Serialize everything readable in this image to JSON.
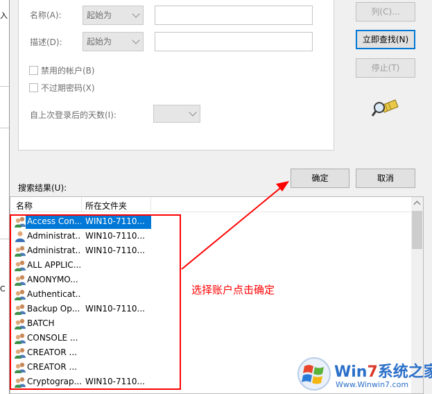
{
  "background": {
    "fragments": [
      "入",
      "C"
    ]
  },
  "form": {
    "name_label": "名称(A):",
    "name_mode": "起始为",
    "name_value": "",
    "desc_label": "描述(D):",
    "desc_mode": "起始为",
    "desc_value": "",
    "disabled_accounts": "禁用的帐户(B)",
    "non_expiring_pw": "不过期密码(X)",
    "days_since_logon_label": "自上次登录后的天数(I):",
    "days_since_logon_value": ""
  },
  "buttons": {
    "columns": "列(C)...",
    "find_now": "立即查找(N)",
    "stop": "停止(T)",
    "ok": "确定",
    "cancel": "取消"
  },
  "results": {
    "label": "搜索结果(U):",
    "columns": [
      "名称",
      "所在文件夹"
    ],
    "rows": [
      {
        "name": "Access Con...",
        "folder": "WIN10-7110...",
        "selected": true,
        "icon": "group-icon"
      },
      {
        "name": "Administrat...",
        "folder": "WIN10-7110...",
        "selected": false,
        "icon": "user-icon"
      },
      {
        "name": "Administrat...",
        "folder": "WIN10-7110...",
        "selected": false,
        "icon": "group-icon"
      },
      {
        "name": "ALL APPLIC...",
        "folder": "",
        "selected": false,
        "icon": "group-icon"
      },
      {
        "name": "ANONYMO...",
        "folder": "",
        "selected": false,
        "icon": "group-icon"
      },
      {
        "name": "Authenticat...",
        "folder": "",
        "selected": false,
        "icon": "group-icon"
      },
      {
        "name": "Backup Op...",
        "folder": "WIN10-7110...",
        "selected": false,
        "icon": "group-icon"
      },
      {
        "name": "BATCH",
        "folder": "",
        "selected": false,
        "icon": "group-icon"
      },
      {
        "name": "CONSOLE ...",
        "folder": "",
        "selected": false,
        "icon": "group-icon"
      },
      {
        "name": "CREATOR ...",
        "folder": "",
        "selected": false,
        "icon": "group-icon"
      },
      {
        "name": "CREATOR ...",
        "folder": "",
        "selected": false,
        "icon": "group-icon"
      },
      {
        "name": "Cryptograp...",
        "folder": "WIN10-7110...",
        "selected": false,
        "icon": "group-icon"
      }
    ]
  },
  "annotation": {
    "text": "选择账户点击确定",
    "color": "#ff0000"
  },
  "watermark": {
    "title_prefix": "Win",
    "title_seven": "7",
    "title_suffix": "系统之家",
    "url": "Www.Winwin7.com"
  },
  "colors": {
    "selection": "#0078d7",
    "focus_border": "#0078d7",
    "annotation": "#ff0000"
  }
}
